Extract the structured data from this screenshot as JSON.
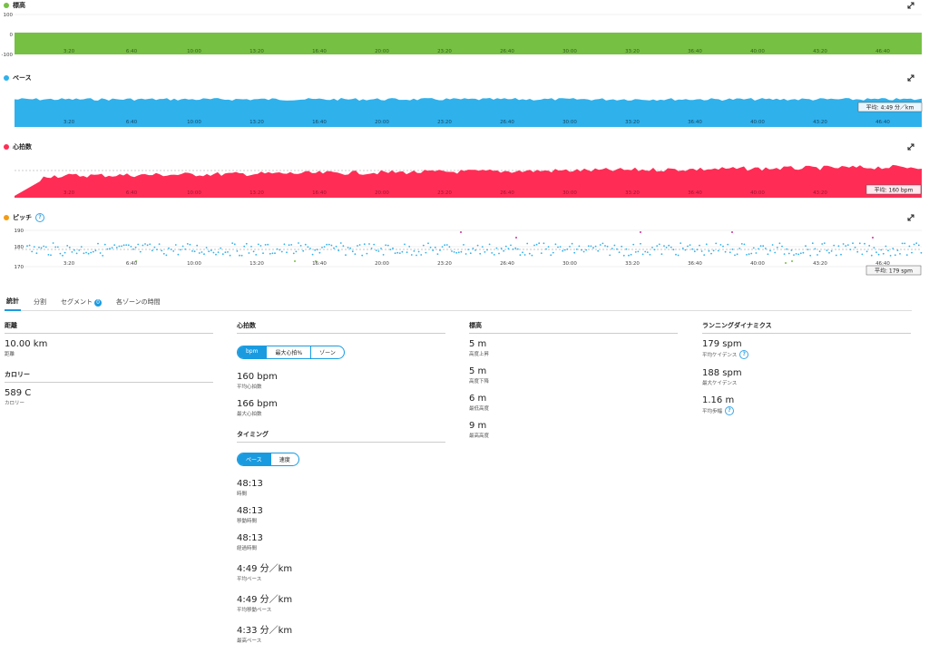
{
  "charts": {
    "elevation": {
      "title": "標高",
      "color": "#76c043",
      "y_ticks": [
        "100",
        "0",
        "-100"
      ],
      "x_ticks": [
        "3:20",
        "6:40",
        "10:00",
        "13:20",
        "16:40",
        "20:00",
        "23:20",
        "26:40",
        "30:00",
        "33:20",
        "36:40",
        "40:00",
        "43:20",
        "46:40"
      ]
    },
    "pace": {
      "title": "ペース",
      "color": "#2fb1ec",
      "avg_label": "平均: 4:49 分／km",
      "x_ticks": [
        "3:20",
        "6:40",
        "10:00",
        "13:20",
        "16:40",
        "20:00",
        "23:20",
        "26:40",
        "30:00",
        "33:20",
        "36:40",
        "40:00",
        "43:20",
        "46:40"
      ]
    },
    "heart_rate": {
      "title": "心拍数",
      "color": "#ff2d55",
      "avg_label": "平均: 160 bpm",
      "x_ticks": [
        "3:20",
        "6:40",
        "10:00",
        "13:20",
        "16:40",
        "20:00",
        "23:20",
        "26:40",
        "30:00",
        "33:20",
        "36:40",
        "40:00",
        "43:20",
        "46:40"
      ]
    },
    "cadence": {
      "title": "ピッチ",
      "color": "#f39c12",
      "y_ticks": [
        "190",
        "180",
        "170"
      ],
      "avg_label": "平均: 179 spm",
      "x_ticks": [
        "3:20",
        "6:40",
        "10:00",
        "13:20",
        "16:40",
        "20:00",
        "23:20",
        "26:40",
        "30:00",
        "33:20",
        "36:40",
        "40:00",
        "43:20",
        "46:40"
      ]
    }
  },
  "tabs": [
    {
      "label": "統計",
      "active": true
    },
    {
      "label": "分割",
      "active": false
    },
    {
      "label": "セグメント",
      "badge": "0",
      "active": false
    },
    {
      "label": "各ゾーンの時間",
      "active": false
    }
  ],
  "stats": {
    "distance": {
      "title": "距離",
      "items": [
        {
          "value": "10.00 km",
          "label": "距離"
        }
      ]
    },
    "calories": {
      "title": "カロリー",
      "items": [
        {
          "value": "589 C",
          "label": "カロリー"
        }
      ]
    },
    "heart": {
      "title": "心拍数",
      "toggle": [
        "bpm",
        "最大心拍%",
        "ゾーン"
      ],
      "items": [
        {
          "value": "160 bpm",
          "label": "平均心拍数"
        },
        {
          "value": "166 bpm",
          "label": "最大心拍数"
        }
      ]
    },
    "timing": {
      "title": "タイミング",
      "toggle": [
        "ペース",
        "速度"
      ],
      "items": [
        {
          "value": "48:13",
          "label": "時間"
        },
        {
          "value": "48:13",
          "label": "移動時間"
        },
        {
          "value": "48:13",
          "label": "経過時間"
        },
        {
          "value": "4:49 分／km",
          "label": "平均ペース"
        },
        {
          "value": "4:49 分／km",
          "label": "平均移動ペース"
        },
        {
          "value": "4:33 分／km",
          "label": "最高ペース"
        }
      ]
    },
    "elevation": {
      "title": "標高",
      "items": [
        {
          "value": "5 m",
          "label": "高度上昇"
        },
        {
          "value": "5 m",
          "label": "高度下降"
        },
        {
          "value": "6 m",
          "label": "最低高度"
        },
        {
          "value": "9 m",
          "label": "最高高度"
        }
      ]
    },
    "dynamics": {
      "title": "ランニングダイナミクス",
      "items": [
        {
          "value": "179 spm",
          "label": "平均ケイデンス"
        },
        {
          "value": "188 spm",
          "label": "最大ケイデンス"
        },
        {
          "value": "1.16 m",
          "label": "平均歩幅"
        }
      ]
    }
  }
}
